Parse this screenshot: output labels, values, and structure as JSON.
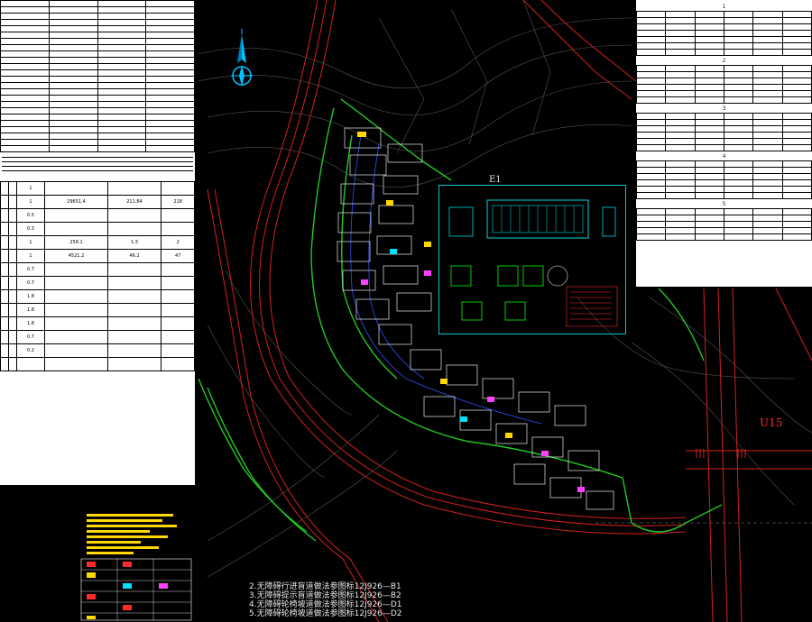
{
  "left_panel": {
    "rows": [
      [
        "",
        "",
        "",
        ""
      ],
      [
        "",
        "",
        "",
        ""
      ],
      [
        "",
        "",
        "",
        ""
      ],
      [
        "",
        "",
        "",
        ""
      ],
      [
        "",
        "",
        "",
        ""
      ],
      [
        "",
        "",
        "",
        ""
      ],
      [
        "",
        "",
        "",
        ""
      ],
      [
        "",
        "",
        "",
        ""
      ],
      [
        "",
        "",
        "",
        ""
      ],
      [
        "",
        "",
        "",
        ""
      ],
      [
        "",
        "",
        "",
        ""
      ],
      [
        "",
        "",
        "",
        ""
      ],
      [
        "",
        "",
        "",
        ""
      ],
      [
        "",
        "",
        "",
        ""
      ],
      [
        "",
        "",
        "",
        ""
      ],
      [
        "",
        "",
        "",
        ""
      ],
      [
        "",
        "",
        "",
        ""
      ],
      [
        "",
        "",
        "",
        ""
      ],
      [
        "",
        "",
        "",
        ""
      ],
      [
        "",
        "",
        "",
        ""
      ],
      [
        "",
        "",
        "",
        ""
      ],
      [
        "",
        "",
        "",
        ""
      ],
      [
        "",
        "",
        "",
        ""
      ],
      [
        "",
        "",
        "",
        ""
      ]
    ],
    "second_title": "",
    "parking_rows": [
      [
        "",
        "",
        "1",
        "",
        "",
        ""
      ],
      [
        "",
        "",
        "1",
        "29651.4",
        "211.84",
        "218"
      ],
      [
        "",
        "",
        "0.5",
        "",
        "",
        ""
      ],
      [
        "",
        "",
        "0.3",
        "",
        "",
        ""
      ],
      [
        "",
        "",
        "1",
        "258.1",
        "1.3",
        "2"
      ],
      [
        "",
        "",
        "1",
        "4521.2",
        "46.2",
        "47"
      ],
      [
        "",
        "",
        "0.7",
        "",
        "",
        ""
      ],
      [
        "",
        "",
        "0.7",
        "",
        "",
        ""
      ],
      [
        "",
        "",
        "1.8",
        "",
        "",
        ""
      ],
      [
        "",
        "",
        "1.8",
        "",
        "",
        ""
      ],
      [
        "",
        "",
        "1.8",
        "",
        "",
        ""
      ],
      [
        "",
        "",
        "0.7",
        "",
        "",
        ""
      ],
      [
        "",
        "",
        "0.2",
        "",
        "",
        ""
      ],
      [
        "",
        "",
        "",
        "",
        "",
        ""
      ]
    ]
  },
  "right_panel": {
    "title": "",
    "tables": [
      {
        "caption": "1",
        "rows": [
          [
            "",
            "",
            "",
            "",
            "",
            ""
          ],
          [
            "",
            "",
            "",
            "",
            "",
            ""
          ],
          [
            "",
            "",
            "",
            "",
            "",
            ""
          ],
          [
            "",
            "",
            "",
            "",
            "",
            ""
          ],
          [
            "",
            "",
            "",
            "",
            "",
            ""
          ],
          [
            "",
            "",
            "",
            "",
            "",
            ""
          ],
          [
            "",
            "",
            "",
            "",
            "",
            ""
          ]
        ]
      },
      {
        "caption": "2",
        "rows": [
          [
            "",
            "",
            "",
            "",
            "",
            ""
          ],
          [
            "",
            "",
            "",
            "",
            "",
            ""
          ],
          [
            "",
            "",
            "",
            "",
            "",
            ""
          ],
          [
            "",
            "",
            "",
            "",
            "",
            ""
          ],
          [
            "",
            "",
            "",
            "",
            "",
            ""
          ],
          [
            "",
            "",
            "",
            "",
            "",
            ""
          ]
        ]
      },
      {
        "caption": "3",
        "rows": [
          [
            "",
            "",
            "",
            "",
            "",
            ""
          ],
          [
            "",
            "",
            "",
            "",
            "",
            ""
          ],
          [
            "",
            "",
            "",
            "",
            "",
            ""
          ],
          [
            "",
            "",
            "",
            "",
            "",
            ""
          ],
          [
            "",
            "",
            "",
            "",
            "",
            ""
          ],
          [
            "",
            "",
            "",
            "",
            "",
            ""
          ]
        ]
      },
      {
        "caption": "4",
        "rows": [
          [
            "",
            "",
            "",
            "",
            "",
            ""
          ],
          [
            "",
            "",
            "",
            "",
            "",
            ""
          ],
          [
            "",
            "",
            "",
            "",
            "",
            ""
          ],
          [
            "",
            "",
            "",
            "",
            "",
            ""
          ],
          [
            "",
            "",
            "",
            "",
            "",
            ""
          ],
          [
            "",
            "",
            "",
            "",
            "",
            ""
          ]
        ]
      },
      {
        "caption": "5",
        "rows": [
          [
            "",
            "",
            "",
            "",
            "",
            ""
          ],
          [
            "",
            "",
            "",
            "",
            "",
            ""
          ],
          [
            "",
            "",
            "",
            "",
            "",
            ""
          ],
          [
            "",
            "",
            "",
            "",
            "",
            ""
          ],
          [
            "",
            "",
            "",
            "",
            "",
            ""
          ]
        ]
      }
    ]
  },
  "road_labels": {
    "u15": "U15",
    "e1": "E1"
  },
  "notes_yellow": [
    "",
    ""
  ],
  "notes_white": [
    "2.无障碍行进盲道做法参图标12J926—B1",
    "3.无障碍提示盲道做法参图标12J926—B2",
    "4.无障碍轮椅坡道做法参图标12J926—D1",
    "5.无障碍轮椅坡道做法参图标12J926—D2"
  ],
  "colors": {
    "background": "#000000",
    "road_red": "#d42020",
    "site_green": "#22c822",
    "building_white": "#e8e8e8",
    "accent_cyan": "#00c8c8",
    "accent_yellow": "#ffd800",
    "compass": "#00c0ff"
  },
  "icons": {
    "compass": "north-arrow-icon"
  }
}
